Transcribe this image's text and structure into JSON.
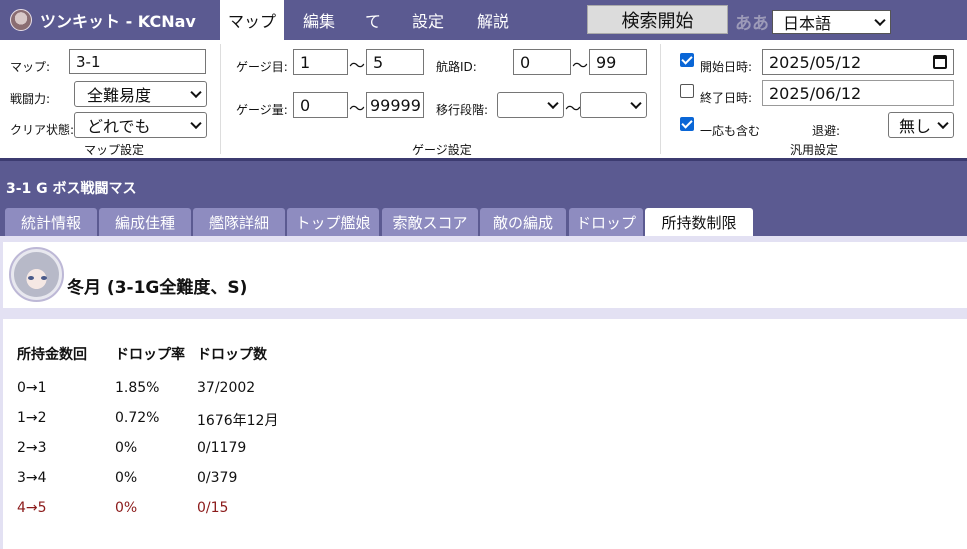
{
  "app": {
    "title": "ツンキット - KCNav"
  },
  "nav": {
    "tabs": [
      {
        "label": "マップ",
        "active": true
      },
      {
        "label": "編集"
      },
      {
        "label": "て"
      },
      {
        "label": "設定"
      },
      {
        "label": "解説"
      }
    ]
  },
  "header": {
    "search_button": "検索開始",
    "aa_label": "ああ",
    "language": "日本語"
  },
  "map_settings": {
    "map_label": "マップ:",
    "map_value": "3-1",
    "difficulty_label": "戦闘力:",
    "difficulty_value": "全難易度",
    "clear_label": "クリア状態:",
    "clear_value": "どれでも",
    "section_label": "マップ設定"
  },
  "gauge_settings": {
    "gauge_num_label": "ゲージ目:",
    "gauge_num_from": "1",
    "gauge_num_to": "5",
    "gauge_amt_label": "ゲージ量:",
    "gauge_amt_from": "0",
    "gauge_amt_to": "99999",
    "route_label": "航路ID:",
    "route_from": "0",
    "route_to": "99",
    "phase_label": "移行段階:",
    "phase_from": "",
    "phase_to": "",
    "tilde": "～",
    "section_label": "ゲージ設定"
  },
  "general_settings": {
    "start_label": "開始日時:",
    "start_checked": true,
    "start_value": "2025/05/12",
    "end_label": "終了日時:",
    "end_checked": false,
    "end_value": "2025/06/12",
    "include_label": "一応も含む",
    "include_checked": true,
    "evade_label": "退避:",
    "evade_value": "無し",
    "section_label": "汎用設定"
  },
  "node": {
    "title": "3-1 G ボス戦闘マス"
  },
  "tabs": [
    {
      "label": "統計情報"
    },
    {
      "label": "編成佳種"
    },
    {
      "label": "艦隊詳細"
    },
    {
      "label": "トップ艦娘"
    },
    {
      "label": "索敵スコア"
    },
    {
      "label": "敵の編成"
    },
    {
      "label": "ドロップ"
    },
    {
      "label": "所持数制限",
      "active": true
    }
  ],
  "ship": {
    "name": "冬月 (3-1G全難度、S)"
  },
  "table": {
    "headers": [
      "所持金数回",
      "ドロップ率",
      "ドロップ数"
    ],
    "rows": [
      {
        "c0": "0→1",
        "c1": "1.85%",
        "c2": "37/2002"
      },
      {
        "c0": "1→2",
        "c1": "0.72%",
        "c2": "1676年12月"
      },
      {
        "c0": "2→3",
        "c1": "0%",
        "c2": "0/1179"
      },
      {
        "c0": "3→4",
        "c1": "0%",
        "c2": "0/379"
      },
      {
        "c0": "4→5",
        "c1": "0%",
        "c2": "0/15"
      }
    ]
  },
  "colors": {
    "header": "#5b5a91",
    "tab_inactive": "#8e8cc0",
    "panel_bg": "#e3e1f3",
    "highlight_row": "#8b1a1a",
    "checkbox": "#0a66d6"
  }
}
